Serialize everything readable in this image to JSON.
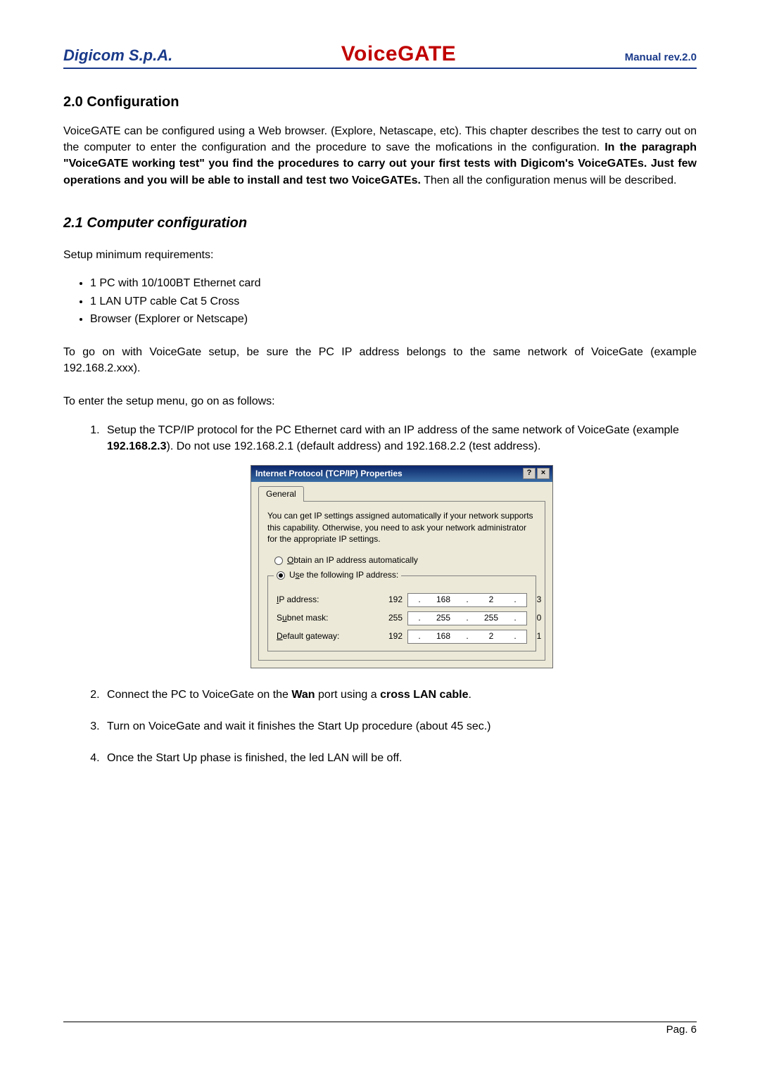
{
  "header": {
    "left": "Digicom S.p.A.",
    "center": "VoiceGATE",
    "right": "Manual rev.2.0"
  },
  "sections": {
    "config_title": "2.0 Configuration",
    "config_para_plain": "VoiceGATE can be configured using a Web browser. (Explore, Netascape, etc). This chapter describes the test to carry out on the computer to enter the configuration and the procedure to save the mofications in the configuration. ",
    "config_para_bold1": "In the paragraph \"VoiceGATE working test\" you find the procedures to carry out your first tests with Digicom's VoiceGATEs. Just few operations and you will be able to install and test two VoiceGATEs.",
    "config_para_tail": " Then all the configuration menus will be described.",
    "comp_title": "2.1 Computer configuration",
    "setup_min": "Setup minimum requirements:",
    "reqs": [
      "1 PC with 10/100BT Ethernet card",
      "1 LAN UTP cable Cat 5 Cross",
      "Browser (Explorer or Netscape)"
    ],
    "net_para": "To go on with VoiceGate setup, be sure the PC IP address belongs to the same network of VoiceGate (example 192.168.2.xxx).",
    "enter_setup": "To enter the setup menu, go on as follows:",
    "step1_pre": "Setup the TCP/IP protocol for the PC Ethernet card with an IP address of the same network of VoiceGate (example ",
    "step1_bold": "192.168.2.3",
    "step1_post": "). Do not use 192.168.2.1 (default address) and 192.168.2.2 (test address).",
    "step2_pre": "Connect the PC to VoiceGate on the ",
    "step2_b1": "Wan",
    "step2_mid": " port using a ",
    "step2_b2": "cross LAN cable",
    "step2_post": ".",
    "step3": "Turn on VoiceGate and wait it finishes the Start Up procedure (about 45 sec.)",
    "step4": "Once the Start Up phase is finished, the led LAN will be off."
  },
  "dialog": {
    "title": "Internet Protocol (TCP/IP) Properties",
    "help_btn": "?",
    "close_btn": "×",
    "tab": "General",
    "desc": "You can get IP settings assigned automatically if your network supports this capability. Otherwise, you need to ask your network administrator for the appropriate IP settings.",
    "radio_auto_u": "O",
    "radio_auto_rest": "btain an IP address automatically",
    "radio_use_pre": "U",
    "radio_use_u": "s",
    "radio_use_rest": "e the following IP address:",
    "ip_label_u": "I",
    "ip_label_rest": "P address:",
    "subnet_label_pre": "S",
    "subnet_label_u": "u",
    "subnet_label_rest": "bnet mask:",
    "gw_label_u": "D",
    "gw_label_rest": "efault gateway:",
    "ip": [
      "192",
      "168",
      "2",
      "3"
    ],
    "mask": [
      "255",
      "255",
      "255",
      "0"
    ],
    "gw": [
      "192",
      "168",
      "2",
      "1"
    ]
  },
  "footer": "Pag. 6"
}
